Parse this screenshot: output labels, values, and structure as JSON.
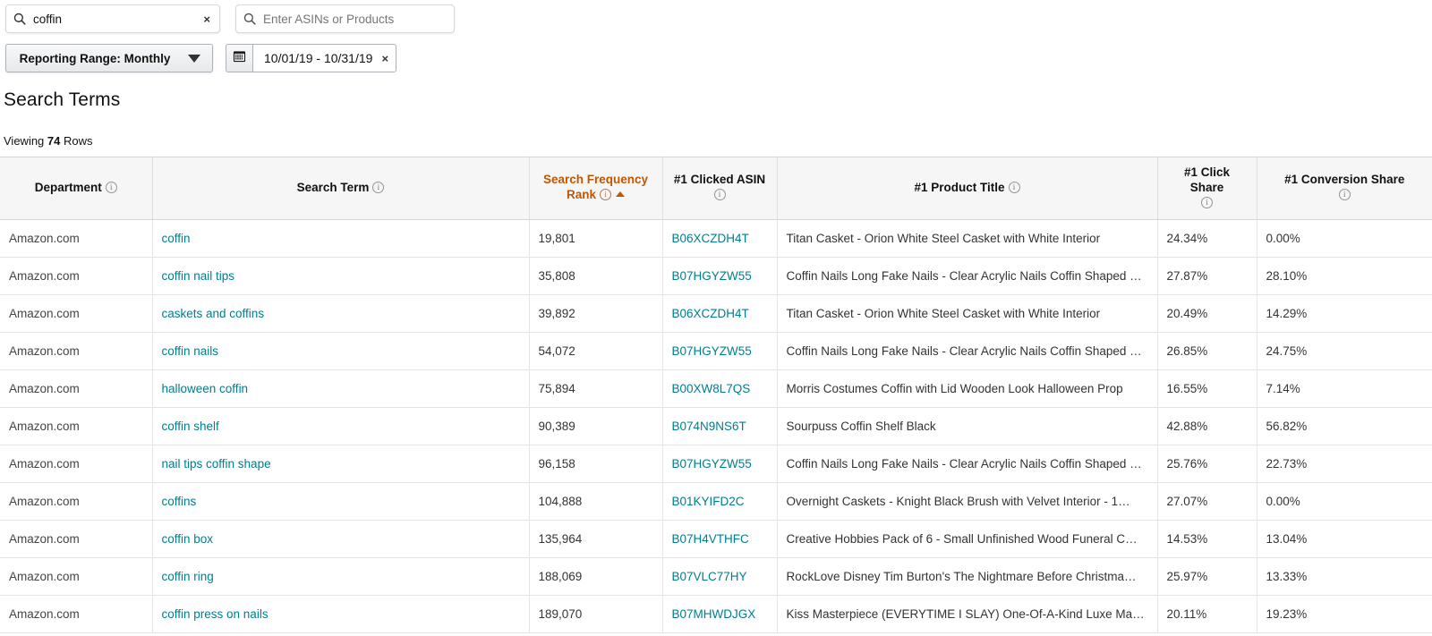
{
  "filters": {
    "keyword_search": {
      "value": "coffin",
      "placeholder": "Search",
      "clear": "×"
    },
    "asin_search": {
      "value": "",
      "placeholder": "Enter ASINs or Products"
    },
    "reporting_range_label": "Reporting Range: Monthly",
    "date_range": "10/01/19  -  10/31/19",
    "date_clear": "×"
  },
  "page": {
    "title": "Search Terms",
    "viewing_prefix": "Viewing",
    "row_count": "74",
    "viewing_suffix": "Rows"
  },
  "table": {
    "columns": [
      {
        "label": "Department",
        "info": true,
        "sorted": false
      },
      {
        "label": "Search Term",
        "info": true,
        "sorted": false
      },
      {
        "label": "Search Frequency Rank",
        "line1": "Search Frequency",
        "line2": "Rank",
        "info": true,
        "sorted": true,
        "sort_dir": "asc"
      },
      {
        "label": "#1 Clicked ASIN",
        "info": true,
        "sorted": false
      },
      {
        "label": "#1 Product Title",
        "info": true,
        "sorted": false
      },
      {
        "label": "#1 Click Share",
        "info": true,
        "sorted": false
      },
      {
        "label": "#1 Conversion Share",
        "info": true,
        "sorted": false
      }
    ],
    "rows": [
      {
        "department": "Amazon.com",
        "search_term": "coffin",
        "search_frequency_rank": "19,801",
        "clicked_asin": "B06XCZDH4T",
        "product_title": "Titan Casket - Orion White Steel Casket with White Interior",
        "click_share": "24.34%",
        "conversion_share": "0.00%"
      },
      {
        "department": "Amazon.com",
        "search_term": "coffin nail tips",
        "search_frequency_rank": "35,808",
        "clicked_asin": "B07HGYZW55",
        "product_title": "Coffin Nails Long Fake Nails - Clear Acrylic Nails Coffin Shaped …",
        "click_share": "27.87%",
        "conversion_share": "28.10%"
      },
      {
        "department": "Amazon.com",
        "search_term": "caskets and coffins",
        "search_frequency_rank": "39,892",
        "clicked_asin": "B06XCZDH4T",
        "product_title": "Titan Casket - Orion White Steel Casket with White Interior",
        "click_share": "20.49%",
        "conversion_share": "14.29%"
      },
      {
        "department": "Amazon.com",
        "search_term": "coffin nails",
        "search_frequency_rank": "54,072",
        "clicked_asin": "B07HGYZW55",
        "product_title": "Coffin Nails Long Fake Nails - Clear Acrylic Nails Coffin Shaped …",
        "click_share": "26.85%",
        "conversion_share": "24.75%"
      },
      {
        "department": "Amazon.com",
        "search_term": "halloween coffin",
        "search_frequency_rank": "75,894",
        "clicked_asin": "B00XW8L7QS",
        "product_title": "Morris Costumes Coffin with Lid Wooden Look Halloween Prop",
        "click_share": "16.55%",
        "conversion_share": "7.14%"
      },
      {
        "department": "Amazon.com",
        "search_term": "coffin shelf",
        "search_frequency_rank": "90,389",
        "clicked_asin": "B074N9NS6T",
        "product_title": "Sourpuss Coffin Shelf Black",
        "click_share": "42.88%",
        "conversion_share": "56.82%"
      },
      {
        "department": "Amazon.com",
        "search_term": "nail tips coffin shape",
        "search_frequency_rank": "96,158",
        "clicked_asin": "B07HGYZW55",
        "product_title": "Coffin Nails Long Fake Nails - Clear Acrylic Nails Coffin Shaped …",
        "click_share": "25.76%",
        "conversion_share": "22.73%"
      },
      {
        "department": "Amazon.com",
        "search_term": "coffins",
        "search_frequency_rank": "104,888",
        "clicked_asin": "B01KYIFD2C",
        "product_title": "Overnight Caskets - Knight Black Brush with Velvet Interior - 1…",
        "click_share": "27.07%",
        "conversion_share": "0.00%"
      },
      {
        "department": "Amazon.com",
        "search_term": "coffin box",
        "search_frequency_rank": "135,964",
        "clicked_asin": "B07H4VTHFC",
        "product_title": "Creative Hobbies Pack of 6 - Small Unfinished Wood Funeral C…",
        "click_share": "14.53%",
        "conversion_share": "13.04%"
      },
      {
        "department": "Amazon.com",
        "search_term": "coffin ring",
        "search_frequency_rank": "188,069",
        "clicked_asin": "B07VLC77HY",
        "product_title": "RockLove Disney Tim Burton's The Nightmare Before Christma…",
        "click_share": "25.97%",
        "conversion_share": "13.33%"
      },
      {
        "department": "Amazon.com",
        "search_term": "coffin press on nails",
        "search_frequency_rank": "189,070",
        "clicked_asin": "B07MHWDJGX",
        "product_title": "Kiss Masterpiece (EVERYTIME I SLAY) One-Of-A-Kind Luxe Man…",
        "click_share": "20.11%",
        "conversion_share": "19.23%"
      }
    ]
  },
  "colors": {
    "link": "#007e8f",
    "sort_accent": "#c45500",
    "header_bg": "#f6f6f6"
  }
}
